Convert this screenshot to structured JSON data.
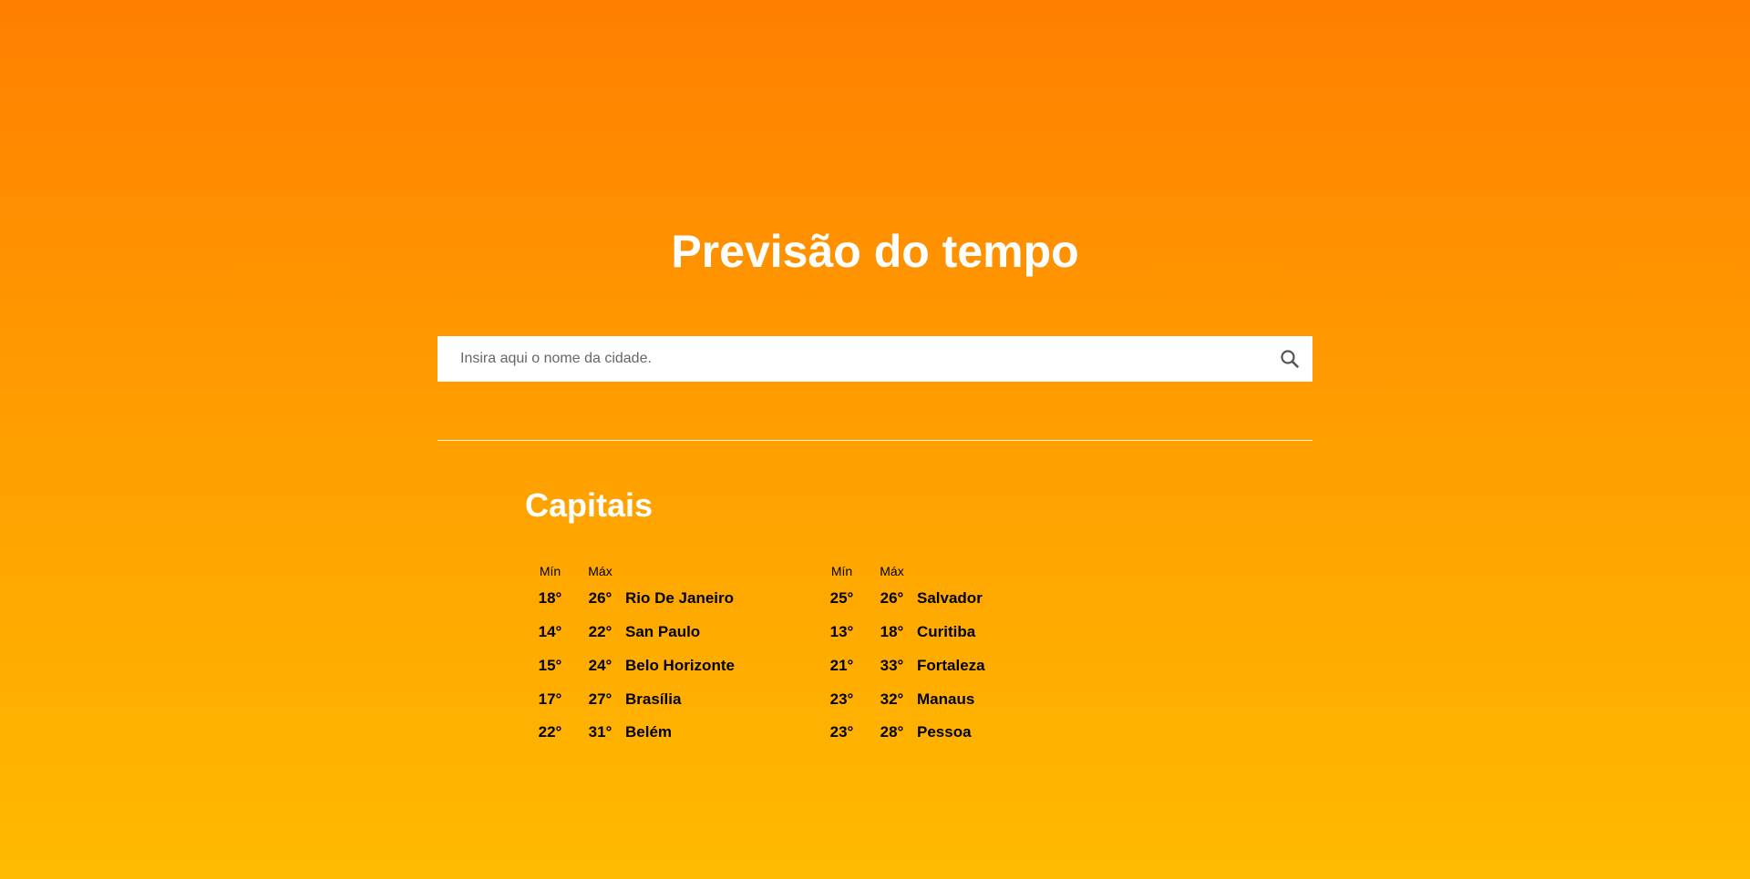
{
  "header": {
    "title": "Previsão do tempo"
  },
  "search": {
    "placeholder": "Insira aqui o nome da cidade.",
    "value": "",
    "icon": "search-icon"
  },
  "capitals": {
    "title": "Capitais",
    "min_label": "Mín",
    "max_label": "Máx",
    "left": [
      {
        "min": "18°",
        "max": "26°",
        "city": "Rio De Janeiro"
      },
      {
        "min": "14°",
        "max": "22°",
        "city": "San Paulo"
      },
      {
        "min": "15°",
        "max": "24°",
        "city": "Belo Horizonte"
      },
      {
        "min": "17°",
        "max": "27°",
        "city": "Brasília"
      },
      {
        "min": "22°",
        "max": "31°",
        "city": "Belém"
      }
    ],
    "right": [
      {
        "min": "25°",
        "max": "26°",
        "city": "Salvador"
      },
      {
        "min": "13°",
        "max": "18°",
        "city": "Curitiba"
      },
      {
        "min": "21°",
        "max": "33°",
        "city": "Fortaleza"
      },
      {
        "min": "23°",
        "max": "32°",
        "city": "Manaus"
      },
      {
        "min": "23°",
        "max": "28°",
        "city": "Pessoa"
      }
    ]
  },
  "colors": {
    "gradient_top": "#ff7f00",
    "gradient_bottom": "#ffba00",
    "title_text": "#ffffff",
    "table_text": "#000000"
  }
}
